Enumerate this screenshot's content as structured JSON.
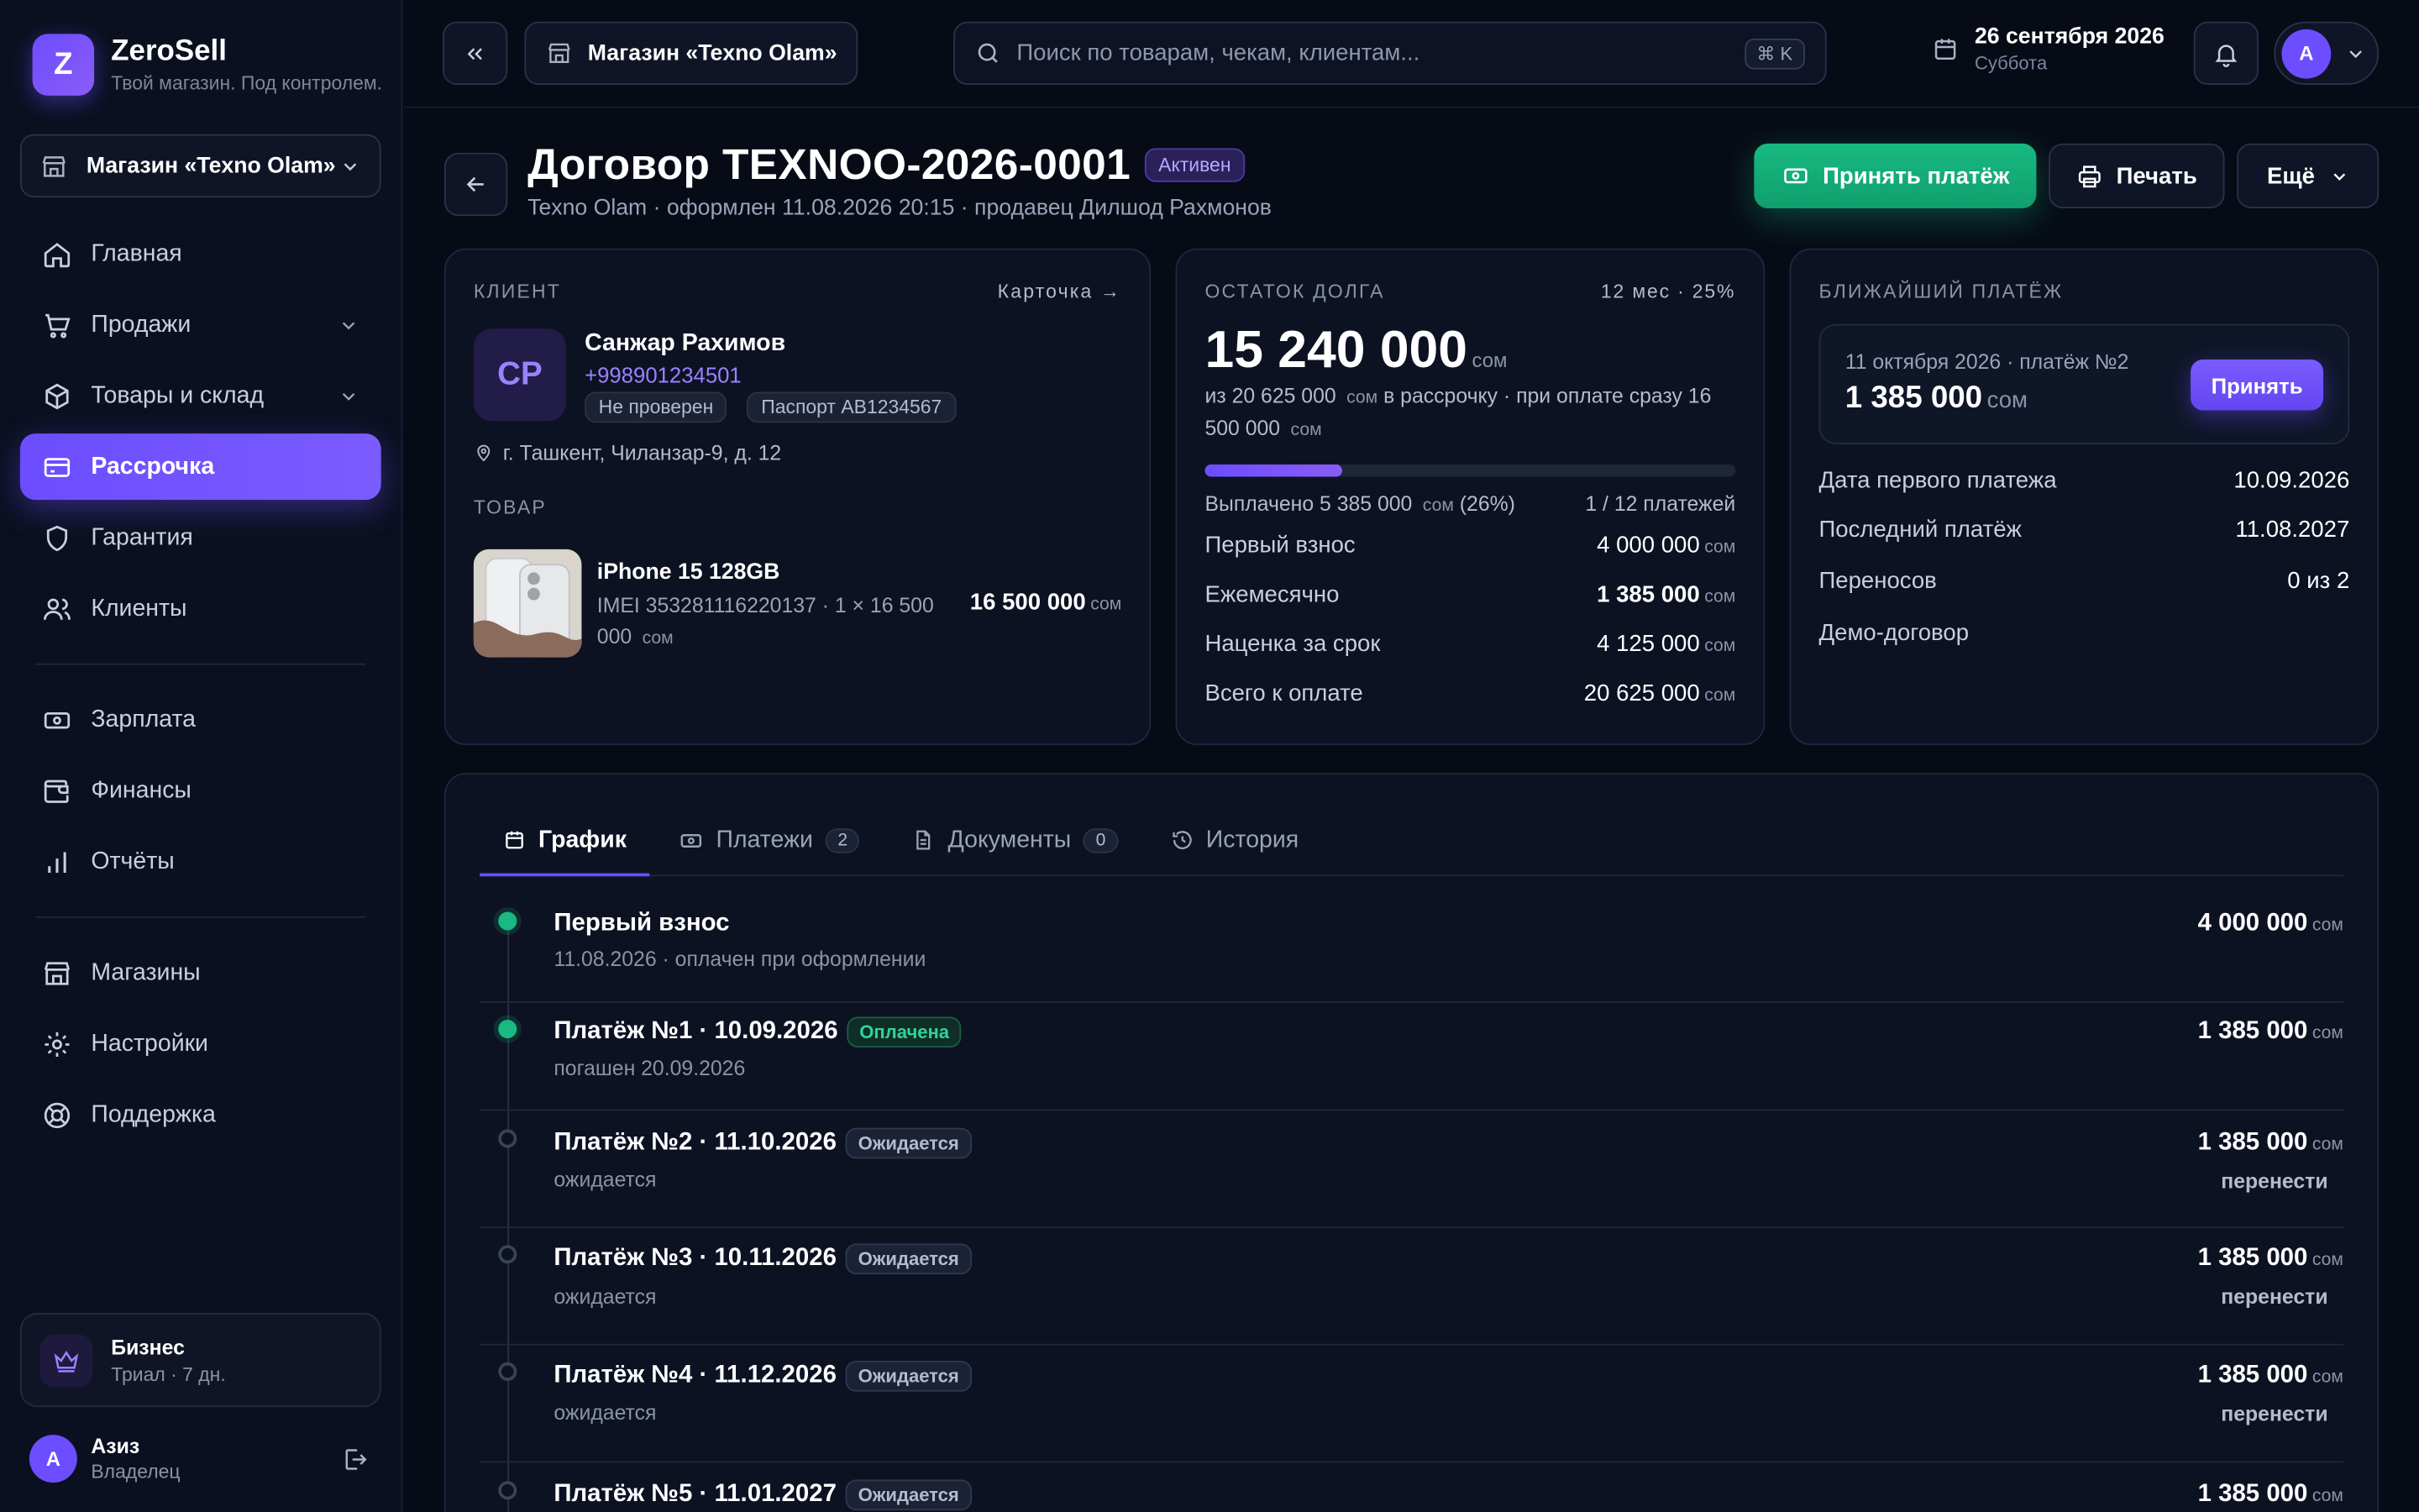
{
  "brand": {
    "name": "ZeroSell",
    "tagline": "Твой магазин. Под контролем.",
    "logo_letter": "Z"
  },
  "sidebar": {
    "store_select": "Магазин «Texno Olam»",
    "items": [
      {
        "label": "Главная",
        "icon": "home-icon"
      },
      {
        "label": "Продажи",
        "icon": "cart-icon"
      },
      {
        "label": "Товары и склад",
        "icon": "box-icon"
      },
      {
        "label": "Рассрочка",
        "icon": "card-icon"
      },
      {
        "label": "Гарантия",
        "icon": "shield-icon"
      },
      {
        "label": "Клиенты",
        "icon": "users-icon"
      },
      {
        "label": "Зарплата",
        "icon": "cash-icon"
      },
      {
        "label": "Финансы",
        "icon": "wallet-icon"
      },
      {
        "label": "Отчёты",
        "icon": "chart-icon"
      },
      {
        "label": "Магазины",
        "icon": "store-icon"
      },
      {
        "label": "Настройки",
        "icon": "gear-icon"
      },
      {
        "label": "Поддержка",
        "icon": "lifebuoy-icon"
      }
    ],
    "plan": {
      "name": "Бизнес",
      "sub": "Триал · 7 дн."
    },
    "user": {
      "initial": "А",
      "name": "Азиз",
      "role": "Владелец"
    }
  },
  "topbar": {
    "store": "Магазин «Texno Olam»",
    "search_placeholder": "Поиск по товарам, чекам, клиентам...",
    "shortcut": "⌘ K",
    "date": "26 сентября 2026",
    "weekday": "Суббота",
    "user_initial": "А"
  },
  "page": {
    "title": "Договор TEXNOO-2026-0001",
    "status": "Активен",
    "subtitle": "Texno Olam · оформлен 11.08.2026 20:15 · продавец Дилшод Рахмонов",
    "actions": {
      "pay": "Принять платёж",
      "print": "Печать",
      "more": "Ещё"
    }
  },
  "client": {
    "label": "Клиент",
    "link": "Карточка →",
    "initials": "СР",
    "name": "Санжар Рахимов",
    "phone": "+998901234501",
    "tags": [
      "Не проверен",
      "Паспорт AB1234567"
    ],
    "address": "г. Ташкент, Чиланзар-9, д. 12",
    "goods_label": "Товар",
    "product": {
      "name": "iPhone 15 128GB",
      "meta": "IMEI 353281116220137 · 1 × 16 500 000",
      "meta_cur": "сом",
      "price": "16 500 000",
      "cur": "сом"
    }
  },
  "debt": {
    "label": "Остаток долга",
    "term": "12 мес · 25%",
    "amount": "15 240 000",
    "cur": "сом",
    "desc_a": "из 20 625 000",
    "desc_b": "в рассрочку · при оплате сразу 16 500 000",
    "progress_percent": 26,
    "paid_text": "Выплачено 5 385 000",
    "paid_suffix": "(26%)",
    "payments_count": "1 / 12 платежей",
    "rows": [
      {
        "k": "Первый взнос",
        "v": "4 000 000"
      },
      {
        "k": "Ежемесячно",
        "v": "1 385 000"
      },
      {
        "k": "Наценка за срок",
        "v": "4 125 000"
      },
      {
        "k": "Всего к оплате",
        "v": "20 625 000"
      }
    ]
  },
  "next": {
    "label": "Ближайший платёж",
    "box_sub": "11 октября 2026 · платёж №2",
    "box_amount": "1 385 000",
    "cur": "сом",
    "accept": "Принять",
    "rows": [
      {
        "k": "Дата первого платежа",
        "v": "10.09.2026"
      },
      {
        "k": "Последний платёж",
        "v": "11.08.2027"
      },
      {
        "k": "Переносов",
        "v": "0 из 2"
      }
    ],
    "note": "Демо-договор"
  },
  "tabs": [
    {
      "label": "График",
      "icon": "calendar-icon",
      "count": ""
    },
    {
      "label": "Платежи",
      "icon": "cash-icon",
      "count": "2"
    },
    {
      "label": "Документы",
      "icon": "document-icon",
      "count": "0"
    },
    {
      "label": "История",
      "icon": "history-icon",
      "count": ""
    }
  ],
  "schedule": {
    "cur": "сом",
    "move_label": "перенести",
    "rows": [
      {
        "title": "Первый взнос",
        "status": "",
        "sub": "11.08.2026 · оплачен при оформлении",
        "amount": "4 000 000",
        "state": "done"
      },
      {
        "title": "Платёж №1 · 10.09.2026",
        "status": "Оплачена",
        "sub": "погашен 20.09.2026",
        "amount": "1 385 000",
        "state": "done"
      },
      {
        "title": "Платёж №2 · 11.10.2026",
        "status": "Ожидается",
        "sub": "ожидается",
        "amount": "1 385 000",
        "state": "wait"
      },
      {
        "title": "Платёж №3 · 10.11.2026",
        "status": "Ожидается",
        "sub": "ожидается",
        "amount": "1 385 000",
        "state": "wait"
      },
      {
        "title": "Платёж №4 · 11.12.2026",
        "status": "Ожидается",
        "sub": "ожидается",
        "amount": "1 385 000",
        "state": "wait"
      },
      {
        "title": "Платёж №5 · 11.01.2027",
        "status": "Ожидается",
        "sub": "",
        "amount": "1 385 000",
        "state": "wait"
      }
    ]
  },
  "colors": {
    "accent": "#6c4dff",
    "success": "#19b981",
    "bg": "#070b16"
  }
}
